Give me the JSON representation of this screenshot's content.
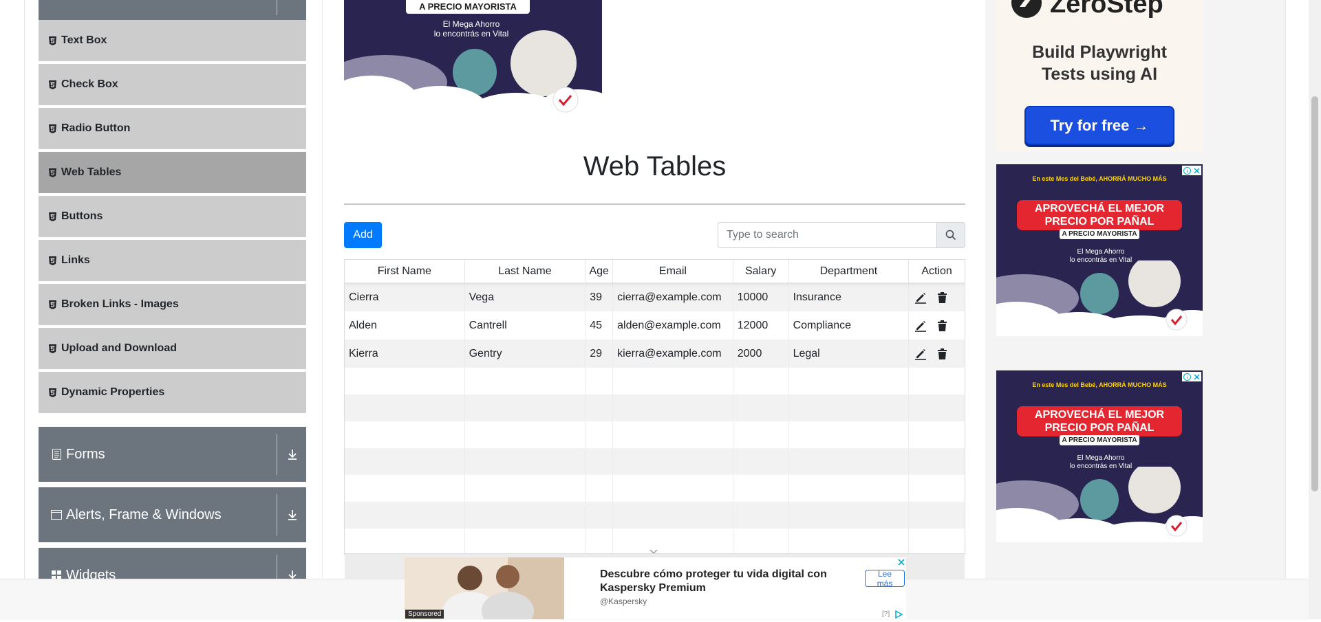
{
  "sidebar": {
    "items": [
      {
        "label": "Text Box"
      },
      {
        "label": "Check Box"
      },
      {
        "label": "Radio Button"
      },
      {
        "label": "Web Tables"
      },
      {
        "label": "Buttons"
      },
      {
        "label": "Links"
      },
      {
        "label": "Broken Links - Images"
      },
      {
        "label": "Upload and Download"
      },
      {
        "label": "Dynamic Properties"
      }
    ],
    "active_item": "Web Tables",
    "groups": [
      {
        "label": "Forms",
        "icon": "document-icon"
      },
      {
        "label": "Alerts, Frame & Windows",
        "icon": "window-icon"
      },
      {
        "label": "Widgets",
        "icon": "widgets-icon"
      }
    ]
  },
  "main": {
    "title": "Web Tables",
    "add_label": "Add",
    "search": {
      "placeholder": "Type to search",
      "value": ""
    },
    "table": {
      "columns": [
        "First Name",
        "Last Name",
        "Age",
        "Email",
        "Salary",
        "Department",
        "Action"
      ],
      "rows": [
        {
          "first": "Cierra",
          "last": "Vega",
          "age": "39",
          "email": "cierra@example.com",
          "salary": "10000",
          "department": "Insurance"
        },
        {
          "first": "Alden",
          "last": "Cantrell",
          "age": "45",
          "email": "alden@example.com",
          "salary": "12000",
          "department": "Compliance"
        },
        {
          "first": "Kierra",
          "last": "Gentry",
          "age": "29",
          "email": "kierra@example.com",
          "salary": "2000",
          "department": "Legal"
        }
      ],
      "empty_rows": 7
    }
  },
  "ads": {
    "top_ad": {
      "line1": "A PRECIO MAYORISTA",
      "line2": "El Mega Ahorro",
      "line3": "lo encontrás en Vital"
    },
    "zerostep": {
      "logo": "ZeroStep",
      "headline_1": "Build Playwright",
      "headline_2": "Tests using AI",
      "button": "Try for free →"
    },
    "vital": {
      "top": "En este Mes del Bebé, AHORRÁ MUCHO MÁS",
      "banner_1": "APROVECHÁ EL MEJOR",
      "banner_2": "PRECIO POR PAÑAL",
      "sub": "A PRECIO MAYORISTA",
      "text_1": "El Mega Ahorro",
      "text_2": "lo encontrás en Vital"
    },
    "bottom": {
      "title": "Descubre cómo proteger tu vida digital con Kaspersky Premium",
      "brand": "@Kaspersky",
      "button": "Lee más",
      "sponsored": "Sponsored",
      "info": "[?]"
    }
  },
  "colors": {
    "accent": "#007bff",
    "sidebar_group": "#6c757d",
    "menu_item": "#cccccc",
    "menu_active": "#a6a6a6"
  }
}
